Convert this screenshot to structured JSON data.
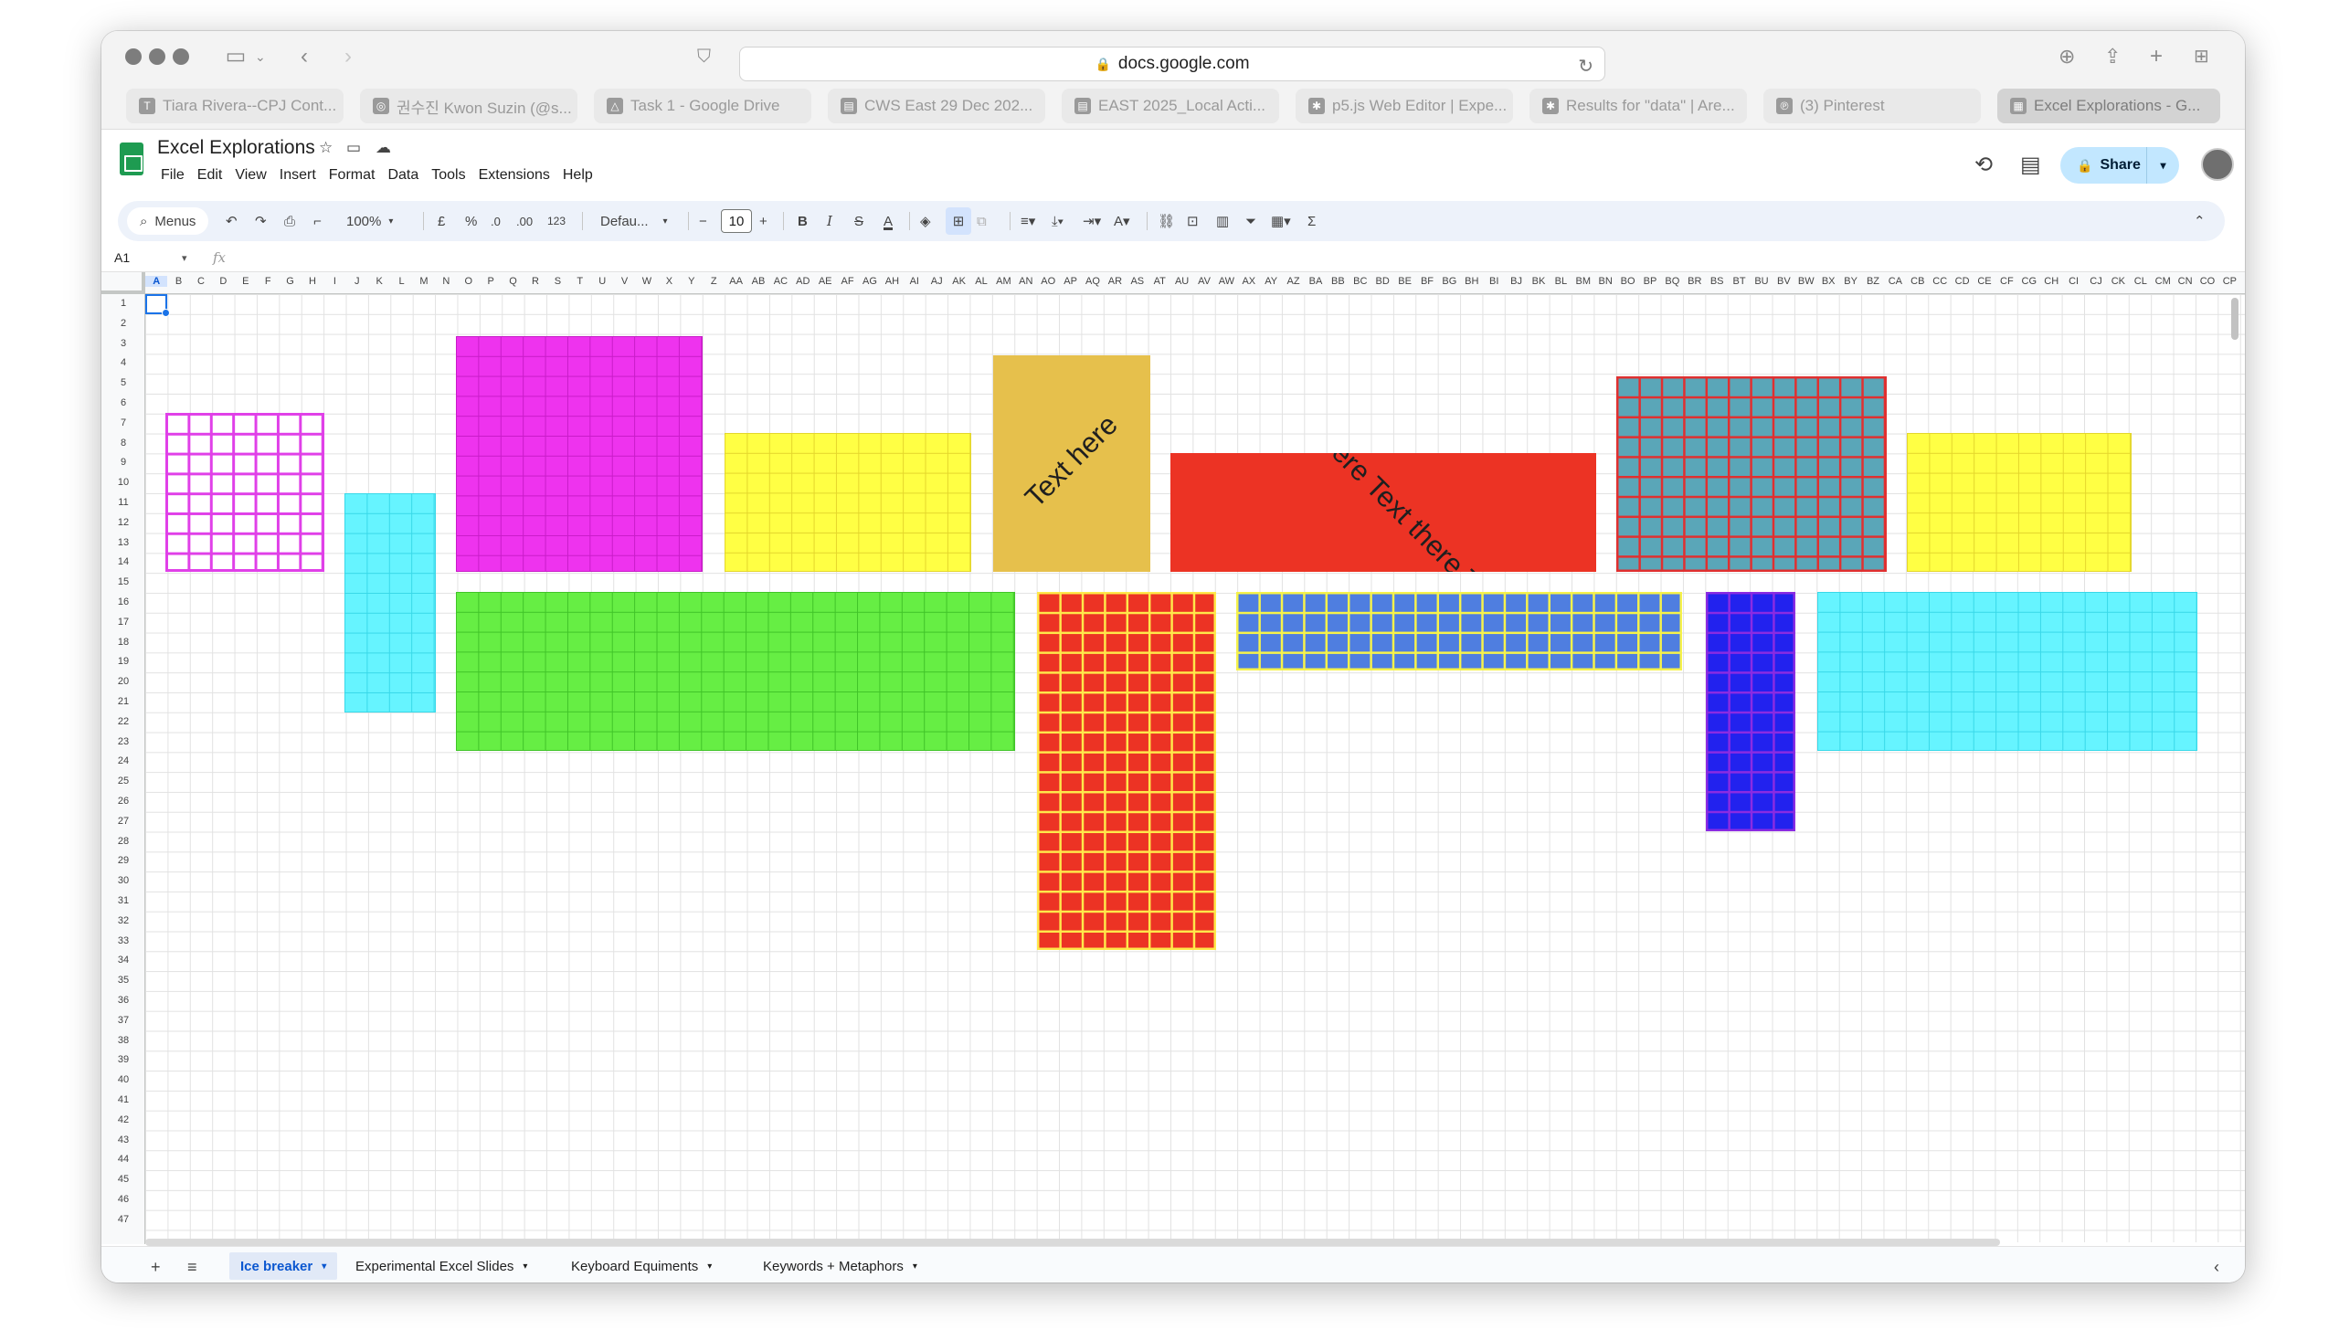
{
  "browser": {
    "url": "docs.google.com",
    "tabs": [
      {
        "label": "Tiara Rivera--CPJ Cont...",
        "icon": "T"
      },
      {
        "label": "권수진 Kwon Suzin (@s...",
        "icon": "◎"
      },
      {
        "label": "Task 1 - Google Drive",
        "icon": "△"
      },
      {
        "label": "CWS East 29 Dec 202...",
        "icon": "▤"
      },
      {
        "label": "EAST 2025_Local Acti...",
        "icon": "▤"
      },
      {
        "label": "p5.js Web Editor | Expe...",
        "icon": "✱"
      },
      {
        "label": "Results for \"data\" | Are...",
        "icon": "✱"
      },
      {
        "label": "(3) Pinterest",
        "icon": "℗"
      },
      {
        "label": "Excel Explorations - G...",
        "icon": "▦"
      }
    ]
  },
  "doc": {
    "title": "Excel Explorations",
    "menu": [
      "File",
      "Edit",
      "View",
      "Insert",
      "Format",
      "Data",
      "Tools",
      "Extensions",
      "Help"
    ],
    "share_label": "Share"
  },
  "toolbar": {
    "search_label": "Menus",
    "zoom": "100%",
    "currency": "£",
    "percent": "%",
    "dec_less": ".0",
    "dec_more": ".00",
    "number_format": "123",
    "font": "Defau...",
    "font_size": "10",
    "bold": "B",
    "italic": "I",
    "strike": "S",
    "text_color": "A",
    "sum": "Σ"
  },
  "formula": {
    "cell_ref": "A1",
    "fx": "fx"
  },
  "columns": [
    "A",
    "B",
    "C",
    "D",
    "E",
    "F",
    "G",
    "H",
    "I",
    "J",
    "K",
    "L",
    "M",
    "N",
    "O",
    "P",
    "Q",
    "R",
    "S",
    "T",
    "U",
    "V",
    "W",
    "X",
    "Y",
    "Z",
    "AA",
    "AB",
    "AC",
    "AD",
    "AE",
    "AF",
    "AG",
    "AH",
    "AI",
    "AJ",
    "AK",
    "AL",
    "AM",
    "AN",
    "AO",
    "AP",
    "AQ",
    "AR",
    "AS",
    "AT",
    "AU",
    "AV",
    "AW",
    "AX",
    "AY",
    "AZ",
    "BA",
    "BB",
    "BC",
    "BD",
    "BE",
    "BF",
    "BG",
    "BH",
    "BI",
    "BJ",
    "BK",
    "BL",
    "BM",
    "BN",
    "BO",
    "BP",
    "BQ",
    "BR",
    "BS",
    "BT",
    "BU",
    "BV",
    "BW",
    "BX",
    "BY",
    "BZ",
    "CA",
    "CB",
    "CC",
    "CD",
    "CE",
    "CF",
    "CG",
    "CH",
    "CI",
    "CJ",
    "CK",
    "CL",
    "CM",
    "CN",
    "CO",
    "CP"
  ],
  "rows": [
    "1",
    "2",
    "3",
    "4",
    "5",
    "6",
    "7",
    "8",
    "9",
    "10",
    "11",
    "12",
    "13",
    "14",
    "15",
    "16",
    "17",
    "18",
    "19",
    "20",
    "21",
    "22",
    "23",
    "24",
    "25",
    "26",
    "27",
    "28",
    "29",
    "30",
    "31",
    "32",
    "33",
    "34",
    "35",
    "36",
    "37",
    "38",
    "39",
    "40",
    "41",
    "42",
    "43",
    "44",
    "45",
    "46",
    "47"
  ],
  "cells": {
    "text_here": "Text here",
    "text_there": "here Text there Text"
  },
  "colors": {
    "magenta_outline": "#e040e8",
    "cyan": "#66f4ff",
    "magenta": "#ee33ee",
    "yellow": "#ffff44",
    "gold": "#e6c04c",
    "red": "#ec3324",
    "teal": "#5aa6b8",
    "green": "#66ee44",
    "blue": "#4f7ee0",
    "deep_blue": "#2222ee",
    "purple": "#8a2be2"
  },
  "sheet_tabs": [
    {
      "label": "Ice breaker",
      "active": true
    },
    {
      "label": "Experimental Excel Slides",
      "active": false
    },
    {
      "label": "Keyboard Equiments",
      "active": false
    },
    {
      "label": "Keywords + Metaphors",
      "active": false
    }
  ]
}
